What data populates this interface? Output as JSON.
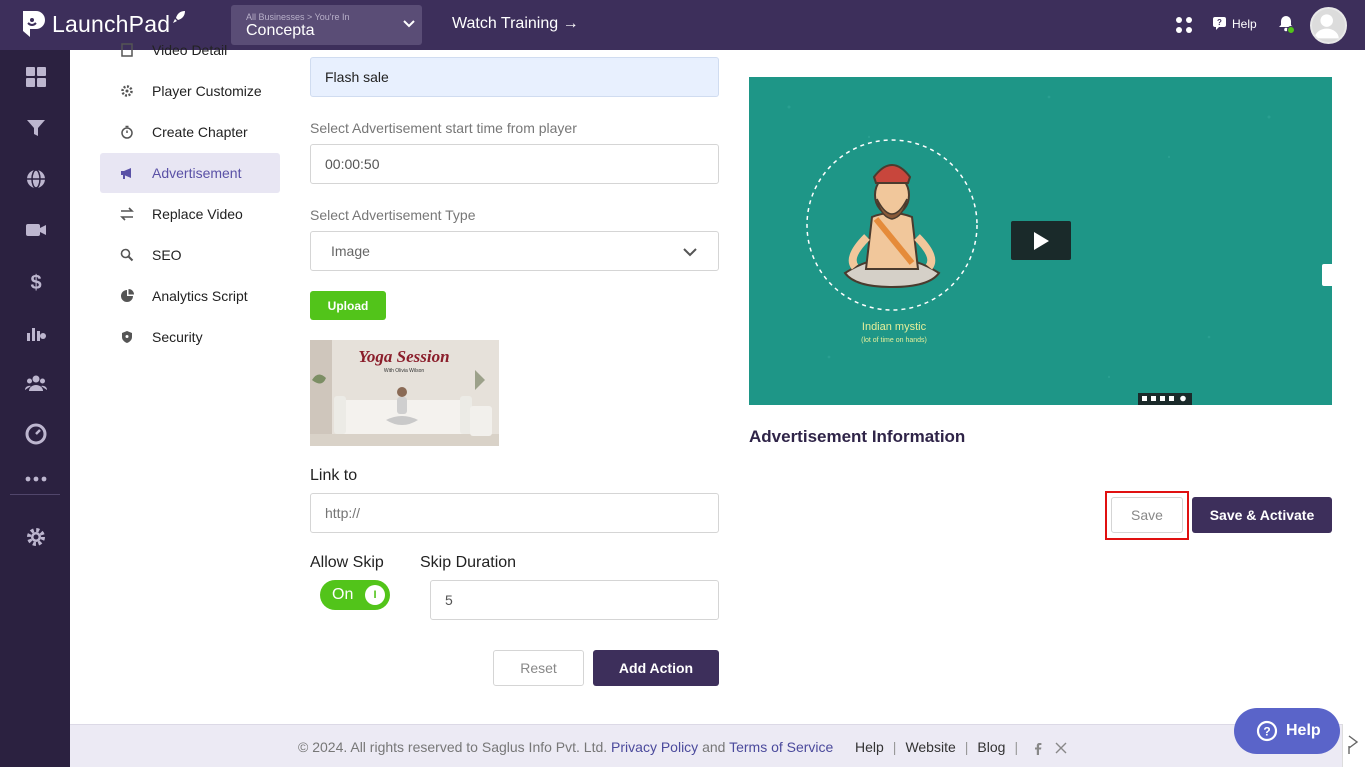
{
  "app": {
    "brand": "LaunchPad",
    "business_subtitle": "All Businesses > You're In",
    "business_name": "Concepta",
    "watch_training": "Watch Training →",
    "help": "Help"
  },
  "rail_icons": [
    "dashboard-icon",
    "funnel-icon",
    "globe-icon",
    "video-camera-icon",
    "dollar-icon",
    "analytics-icon",
    "users-icon",
    "gauge-icon",
    "more-icon",
    "settings-icon"
  ],
  "subnav": {
    "items": [
      {
        "label": "Video Detail",
        "icon": "file-icon"
      },
      {
        "label": "Player Customize",
        "icon": "gear-icon"
      },
      {
        "label": "Create Chapter",
        "icon": "timer-icon"
      },
      {
        "label": "Advertisement",
        "icon": "megaphone-icon",
        "active": true
      },
      {
        "label": "Replace Video",
        "icon": "swap-icon"
      },
      {
        "label": "SEO",
        "icon": "seo-search-icon"
      },
      {
        "label": "Analytics Script",
        "icon": "pie-icon"
      },
      {
        "label": "Security",
        "icon": "shield-icon"
      }
    ]
  },
  "form": {
    "ad_name_value": "Flash sale",
    "start_time_label": "Select Advertisement start time from player",
    "start_time_value": "00:00:50",
    "type_label": "Select Advertisement Type",
    "type_value": "Image",
    "upload_label": "Upload",
    "thumb_title": "Yoga Session",
    "thumb_subtitle": "With Olivia Wilson",
    "link_label": "Link to",
    "link_placeholder": "http://",
    "allow_skip_label": "Allow Skip",
    "skip_toggle": "On",
    "skip_knob": "I",
    "skip_duration_label": "Skip Duration",
    "skip_duration_value": "5",
    "reset_label": "Reset",
    "add_action_label": "Add Action"
  },
  "video": {
    "caption": "Indian mystic",
    "subcaption": "(lot of time on hands)"
  },
  "ad_info": {
    "title": "Advertisement Information",
    "save_label": "Save",
    "save_activate_label": "Save & Activate"
  },
  "footer": {
    "copyright": "©  2024. All rights reserved to Saglus Info Pvt. Ltd.",
    "privacy": "Privacy Policy",
    "and": "and",
    "terms": "Terms of Service",
    "help": "Help",
    "website": "Website",
    "blog": "Blog",
    "sep": "|"
  },
  "help_fab": "Help",
  "colors": {
    "topbar": "#3d2f5b",
    "rail": "#2b2140",
    "accent_green": "#52c41a",
    "video_bg": "#1e9687",
    "highlight_red": "#e01010"
  }
}
